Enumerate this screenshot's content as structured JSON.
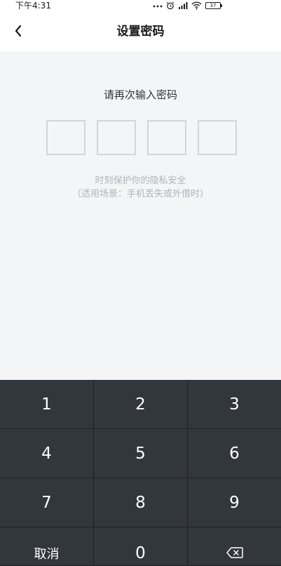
{
  "status_bar": {
    "time": "下午4:31",
    "battery_level": "37",
    "icons": [
      "more-dots-icon",
      "alarm-icon",
      "signal-icon",
      "wifi-icon",
      "battery-icon"
    ]
  },
  "header": {
    "title": "设置密码",
    "back_icon": "chevron-left-icon"
  },
  "content": {
    "prompt": "请再次输入密码",
    "pin_length": 4,
    "hint_line1": "时刻保护你的隐私安全",
    "hint_line2": "（适用场景：手机丢失或外借时）"
  },
  "keypad": {
    "keys": [
      "1",
      "2",
      "3",
      "4",
      "5",
      "6",
      "7",
      "8",
      "9",
      "取消",
      "0"
    ],
    "delete_icon": "backspace-icon"
  },
  "colors": {
    "content_bg": "#f4f5f7",
    "keypad_bg": "#32373d",
    "pin_border": "#d4d5d8",
    "hint_text": "#b0b3b8"
  }
}
